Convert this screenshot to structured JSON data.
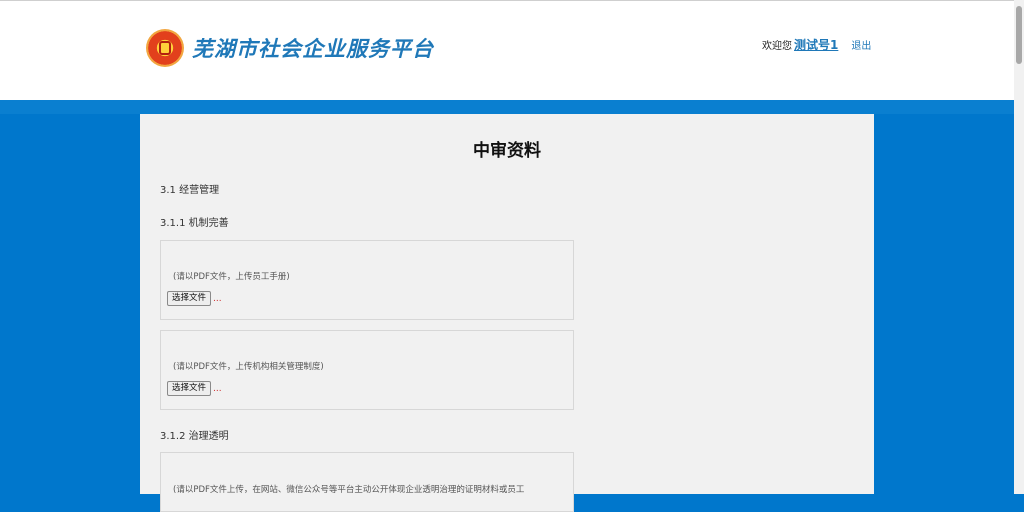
{
  "header": {
    "logo_text": "芜湖市社会企业服务平台",
    "welcome_text": "欢迎您",
    "username": "测试号1",
    "logout_label": "退出"
  },
  "page": {
    "title": "中审资料",
    "sections": {
      "s31": "3.1 经营管理",
      "s311": "3.1.1 机制完善",
      "s312": "3.1.2 治理透明"
    },
    "uploads": [
      {
        "hint": "(请以PDF文件，上传员工手册)",
        "button_label": "选择文件",
        "status": "..."
      },
      {
        "hint": "(请以PDF文件，上传机构相关管理制度)",
        "button_label": "选择文件",
        "status": "..."
      },
      {
        "hint": "(请以PDF文件上传，在网站、微信公众号等平台主动公开体现企业透明治理的证明材料或员工"
      }
    ]
  },
  "colors": {
    "background_blue": "#0077cc",
    "brand_blue": "#1f78b8",
    "panel_gray": "#f1f1f1",
    "status_red": "#cc2a2a"
  }
}
